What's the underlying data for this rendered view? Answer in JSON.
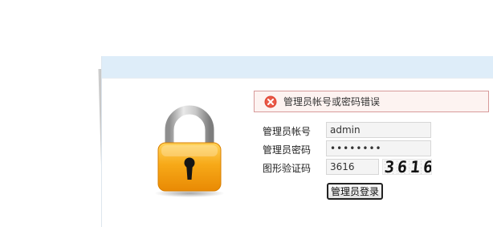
{
  "error": {
    "message": "管理员帐号或密码错误",
    "icon": "error-x-icon",
    "color": "#e04a3a"
  },
  "form": {
    "account_label": "管理员帐号",
    "account_value": "admin",
    "password_label": "管理员密码",
    "password_value": "adminpwd",
    "captcha_label": "图形验证码",
    "captcha_value": "3616",
    "captcha_image_text": "3616",
    "submit_label": "管理员登录"
  },
  "illustration": {
    "icon": "padlock-icon",
    "body_color": "#f5a00f",
    "shackle_color": "#b8b8b8"
  },
  "header": {
    "background_color": "#deedf9"
  }
}
